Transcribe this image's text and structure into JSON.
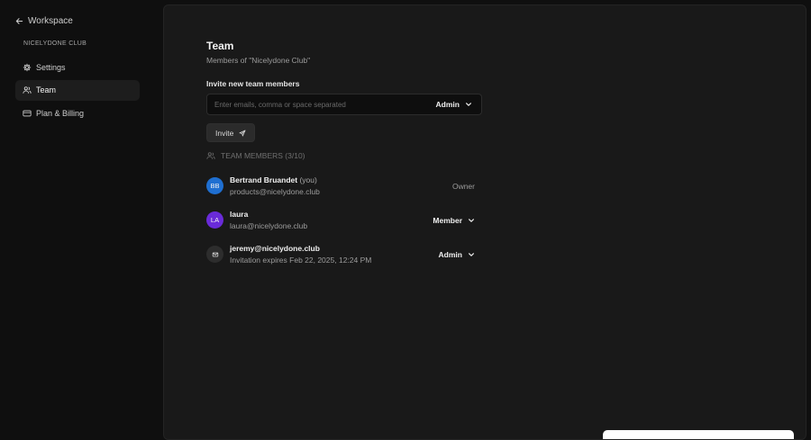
{
  "sidebar": {
    "back_label": "Workspace",
    "org_label": "NICELYDONE CLUB",
    "items": [
      {
        "label": "Settings",
        "icon": "gear-icon",
        "active": false
      },
      {
        "label": "Team",
        "icon": "users-icon",
        "active": true
      },
      {
        "label": "Plan & Billing",
        "icon": "credit-card-icon",
        "active": false
      }
    ]
  },
  "main": {
    "title": "Team",
    "subtitle": "Members of \"Nicelydone Club\"",
    "invite": {
      "label": "Invite new team members",
      "placeholder": "Enter emails, comma or space separated",
      "role": "Admin",
      "button_label": "Invite"
    },
    "members_header": "TEAM MEMBERS (3/10)",
    "members": [
      {
        "initials": "BB",
        "name": "Bertrand Bruandet",
        "suffix": "(you)",
        "email": "products@nicelydone.club",
        "role": "Owner"
      },
      {
        "initials": "LA",
        "name": "laura",
        "email": "laura@nicelydone.club",
        "role": "Member"
      },
      {
        "name": "jeremy@nicelydone.club",
        "email": "Invitation expires Feb 22, 2025, 12:24 PM",
        "role": "Admin"
      }
    ]
  },
  "colors": {
    "avatar_bb": "#1f6fd1",
    "avatar_la": "#6a2bd9",
    "panel_bg": "#191919",
    "page_bg": "#0f0f0f"
  }
}
